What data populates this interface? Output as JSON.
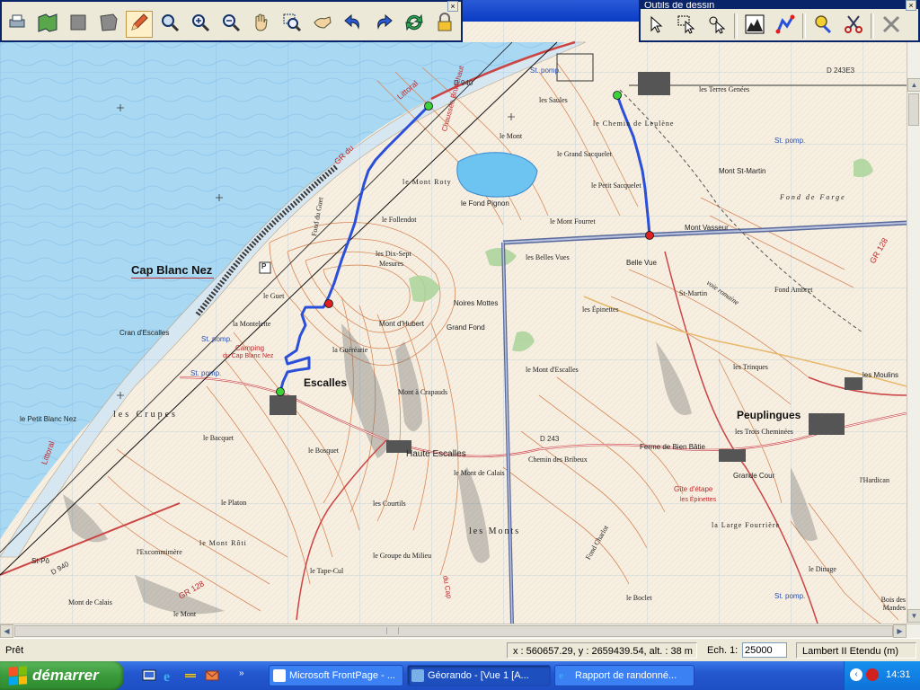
{
  "window": {
    "main_toolbar_close": "×",
    "draw_toolbar_title": "Outils de dessin",
    "draw_toolbar_close": "×"
  },
  "map": {
    "labels": {
      "littoral_top": "Littoral",
      "littoral_left": "Littoral",
      "gr_du": "GR du",
      "d940_top": "D 940",
      "d940_left": "D 940",
      "d243": "D 243",
      "d243e3": "D 243E3",
      "cap_blanc_nez": "Cap Blanc Nez",
      "cran_escalles": "Cran d'Escalles",
      "escalles": "Escalles",
      "peuplingues": "Peuplingues",
      "haute_escalles": "Haute Escalles",
      "le_petit_blanc_nez": "le Petit Blanc Nez",
      "les_crupes": "les Crupes",
      "le_bacquet": "le Bacquet",
      "le_bosquet": "le Bosquet",
      "le_platon": "le Platon",
      "excommimere": "l'Excommimère",
      "mont_roti": "le Mont Rôti",
      "tape_cul": "le Tape-Cul",
      "groupe_milieu": "le Groupe du Milieu",
      "mont_calais": "le Mont de Calais",
      "les_courtils": "les Courtils",
      "les_monts": "les Monts",
      "mont_de_calais_bl": "Mont de Calais",
      "le_mont_bl": "le Mont",
      "la_montelette": "la Montelette",
      "mont_hubert": "Mont d'Hubert",
      "grand_fond": "Grand Fond",
      "noires_mottes": "Noires Mottes",
      "les_dix_sept": "les Dix-Sept",
      "mesures": "Mesures",
      "le_fond_pignon": "le Fond Pignon",
      "le_mont_roty": "le Mont Roty",
      "le_follendot": "le Follendot",
      "le_mont": "le Mont",
      "les_saules": "les Saules",
      "chemin_leulene": "le Chemin de Leulène",
      "grand_sacquelet": "le Grand Sacquelet",
      "petit_sacquelet": "le Petit Sacquelet",
      "mont_fourret": "le Mont Fourret",
      "les_belles_vues": "les Belles Vues",
      "belle_vue": "Belle Vue",
      "mont_vasseur": "Mont Vasseur",
      "les_terres_genees": "les Terres Genées",
      "mont_st_martin": "Mont St-Martin",
      "st_martin": "St-Martin",
      "fond_ambret": "Fond Ambret",
      "les_epinettes": "les Épinettes",
      "mont_escalles": "le Mont d'Escalles",
      "mont_crapauds": "Mont à Crapauds",
      "les_trinques": "les Trinques",
      "les_moulins": "les Moulins",
      "trois_cheminees": "les Trois Cheminées",
      "ferme_bien_batie": "Ferme de Bien Bâtie",
      "chemin_bribeux": "Chemin des Bribeux",
      "grande_cour": "Grande Cour",
      "gite_etape": "Gîte d'étape",
      "les_epinettes_red": "les Épinettes",
      "large_fourriere": "la Large Fourrière",
      "le_dinage": "le Dinage",
      "le_boclet": "le Boclet",
      "fond_charlot": "Fond Charlot",
      "l_hardican": "l'Hardican",
      "bois_mandes": "Bois des Mandes",
      "camping": "Camping",
      "camping2": "du Cap Blanc Nez",
      "st_pomp_top": "St. pomp.",
      "st_pomp_left": "St. pomp.",
      "st_pomp_esc": "St. pomp.",
      "st_pomp_right": "St. pomp.",
      "st_pomp_br": "St. pomp.",
      "st_po": "St-Pô",
      "la_guerearie": "la Guéréarie",
      "le_guet": "le Guet",
      "fond_du_guet": "Fond du Guet",
      "gr_128": "GR 128",
      "gr_128_left": "GR 128",
      "fond_de_forge": "Fond de Forge",
      "voie_romaine": "voie romaine",
      "chaussee": "Chaussée Brunehaut",
      "du_cap": "du Cap",
      "p_letter": "P"
    }
  },
  "status": {
    "ready": "Prêt",
    "coords": "x : 560657.29, y : 2659439.54, alt. : 38 m",
    "scale_label": "Ech. 1:",
    "scale_value": "25000",
    "projection": "Lambert II Etendu (m)"
  },
  "taskbar": {
    "start_label": "démarrer",
    "tasks": [
      "Microsoft FrontPage - ...",
      "Géorando - [Vue 1 [A...",
      "Rapport de randonné..."
    ],
    "clock": "14:31"
  },
  "colors": {
    "sea": "#a9d8f2",
    "land": "#f6efe2",
    "contour": "#d78a5a",
    "track": "#2b4fd8",
    "start_point": "#3bd13b",
    "end_point": "#e02020",
    "taskbar": "#2458d0",
    "start": "#3a9a3a"
  },
  "icons": [
    "print-icon",
    "map-open-icon",
    "layer-icon",
    "grid-icon",
    "pencil-icon",
    "zoom-icon",
    "zoom-in-icon",
    "zoom-out-icon",
    "pan-hand-icon",
    "zoom-window-icon",
    "grab-icon",
    "undo-icon",
    "redo-icon",
    "refresh-icon",
    "lock-icon",
    "select-arrow-icon",
    "select-area-icon",
    "select-node-icon",
    "profile-icon",
    "track-icon",
    "waypoint-icon",
    "cut-icon",
    "delete-icon"
  ]
}
